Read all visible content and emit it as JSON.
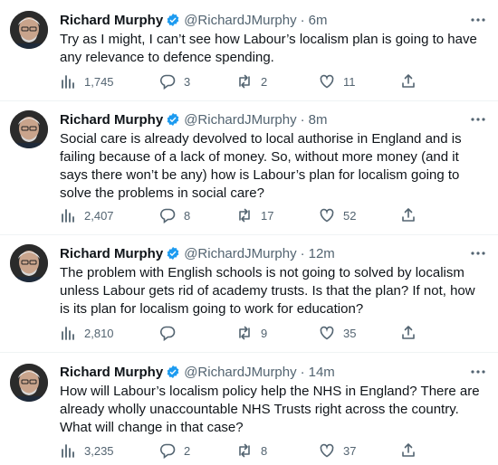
{
  "author": {
    "name": "Richard Murphy",
    "handle": "@RichardJMurphy",
    "separator": "·"
  },
  "tweets": [
    {
      "time": "6m",
      "text": "Try as I might, I can’t see how Labour’s localism plan is going to have any relevance to defence spending.",
      "views": "1,745",
      "replies": "3",
      "retweets": "2",
      "likes": "11"
    },
    {
      "time": "8m",
      "text": "Social care is already devolved to local authorise in England and is failing because of a lack of money. So, without more money (and it says there won’t be any) how is Labour’s plan for localism going to solve the problems in social care?",
      "views": "2,407",
      "replies": "8",
      "retweets": "17",
      "likes": "52"
    },
    {
      "time": "12m",
      "text": "The problem with English schools is not going to solved by localism unless Labour gets rid of academy trusts. Is that the plan? If not, how is its plan for localism going to work for education?",
      "views": "2,810",
      "replies": "",
      "retweets": "9",
      "likes": "35"
    },
    {
      "time": "14m",
      "text": "How will Labour’s localism policy help the NHS in England? There are already wholly unaccountable NHS Trusts right across the country. What will change in that case?",
      "views": "3,235",
      "replies": "2",
      "retweets": "8",
      "likes": "37"
    }
  ],
  "colors": {
    "text": "#0f1419",
    "secondary": "#536471",
    "verified": "#1d9bf0",
    "divider": "#eff3f4"
  },
  "icons": [
    "views-icon",
    "reply-icon",
    "retweet-icon",
    "like-icon",
    "share-icon",
    "more-icon",
    "verified-badge-icon"
  ]
}
